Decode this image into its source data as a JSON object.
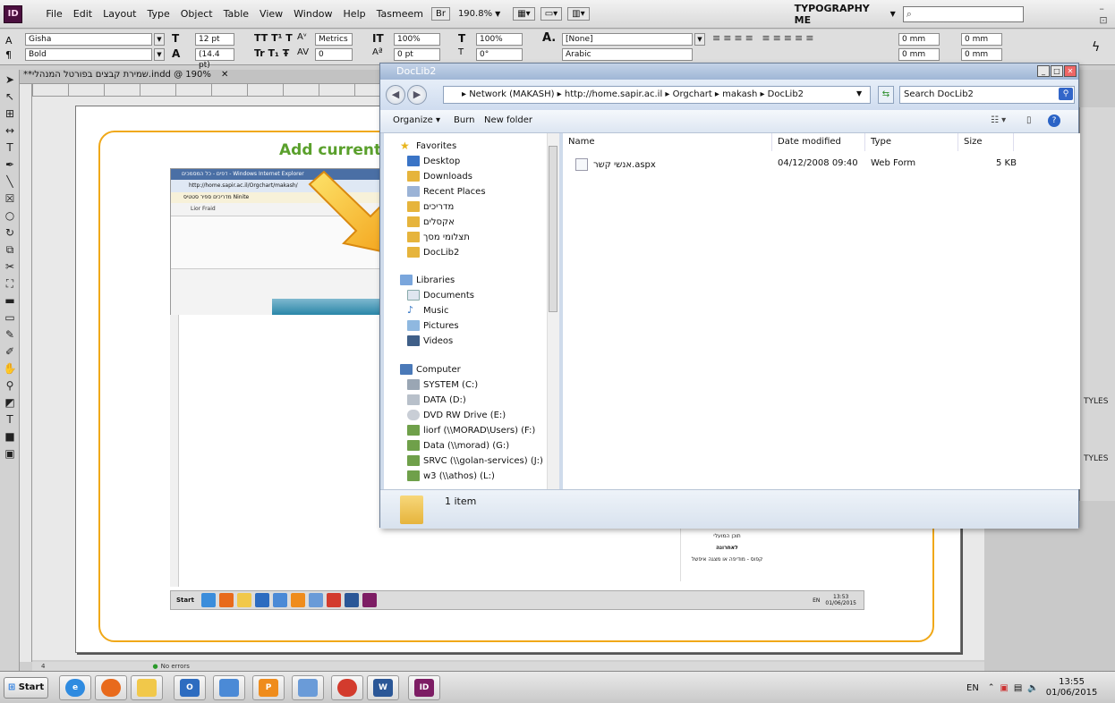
{
  "app": {
    "logo": "ID",
    "menu": [
      "File",
      "Edit",
      "Layout",
      "Type",
      "Object",
      "Table",
      "View",
      "Window",
      "Help",
      "Tasmeem"
    ],
    "bridge": "Br",
    "zoom": "190.8%",
    "workspace": "TYPOGRAPHY ME",
    "window_controls": "–  ⊡"
  },
  "control_panel": {
    "font": "Gisha",
    "style": "Bold",
    "size": "12 pt",
    "leading": "(14.4 pt)",
    "kerning": "Metrics",
    "tracking": "0",
    "hscale": "100%",
    "vscale": "100%",
    "baseline": "0 pt",
    "skew": "0°",
    "char_style": "[None]",
    "language": "Arabic",
    "indent1": "0 mm",
    "indent2": "0 mm",
    "indent3": "0 mm",
    "indent4": "0 mm"
  },
  "document": {
    "tab_title": "**שמירת קבצים בפורטל המנהלי.indd @ 190%",
    "heading": "Add current",
    "status": "No errors",
    "page_num": "4"
  },
  "panels": {
    "styles1": "TYLES",
    "styles2": "TYLES"
  },
  "screenshot": {
    "title": "דפים - כל המסמכים - Windows Internet Explorer",
    "address": "http://home.sapir.ac.il/Orgchart/makash/",
    "favorites": "מדריכים  ספיר  סטטיס  Ninite",
    "user": "Lior Fraid",
    "right_text_1": "תוכן המועלי",
    "right_text_2": "לאחרונה",
    "right_text_3": "קפוס - מודיפה או מצגה איפשל",
    "tray_time": "13:53",
    "tray_date": "01/06/2015",
    "tray_lang": "EN",
    "start": "Start"
  },
  "dialog": {
    "title": "DocLib2",
    "address": "▸ Network (MAKASH) ▸ http://home.sapir.ac.il ▸ Orgchart ▸ makash ▸ DocLib2",
    "search_placeholder": "Search DocLib2",
    "toolbar": {
      "organize": "Organize ▾",
      "burn": "Burn",
      "new_folder": "New folder"
    },
    "nav": {
      "favorites": "Favorites",
      "fav_items": [
        "Desktop",
        "Downloads",
        "Recent Places",
        "מדריכים",
        "אקסלים",
        "תצלומי מסך",
        "DocLib2"
      ],
      "libraries": "Libraries",
      "lib_items": [
        "Documents",
        "Music",
        "Pictures",
        "Videos"
      ],
      "computer": "Computer",
      "drives": [
        "SYSTEM (C:)",
        "DATA (D:)",
        "DVD RW Drive (E:)",
        "liorf (\\\\MORAD\\Users) (F:)",
        "Data (\\\\morad) (G:)",
        "SRVC (\\\\golan-services) (J:)",
        "w3 (\\\\athos) (L:)"
      ]
    },
    "columns": {
      "name": "Name",
      "date": "Date modified",
      "type": "Type",
      "size": "Size"
    },
    "files": [
      {
        "name": "אנשי קשר.aspx",
        "date": "04/12/2008 09:40",
        "type": "Web Form",
        "size": "5 KB"
      }
    ],
    "item_count": "1 item"
  },
  "taskbar": {
    "start": "Start",
    "lang": "EN",
    "time": "13:55",
    "date": "01/06/2015"
  }
}
